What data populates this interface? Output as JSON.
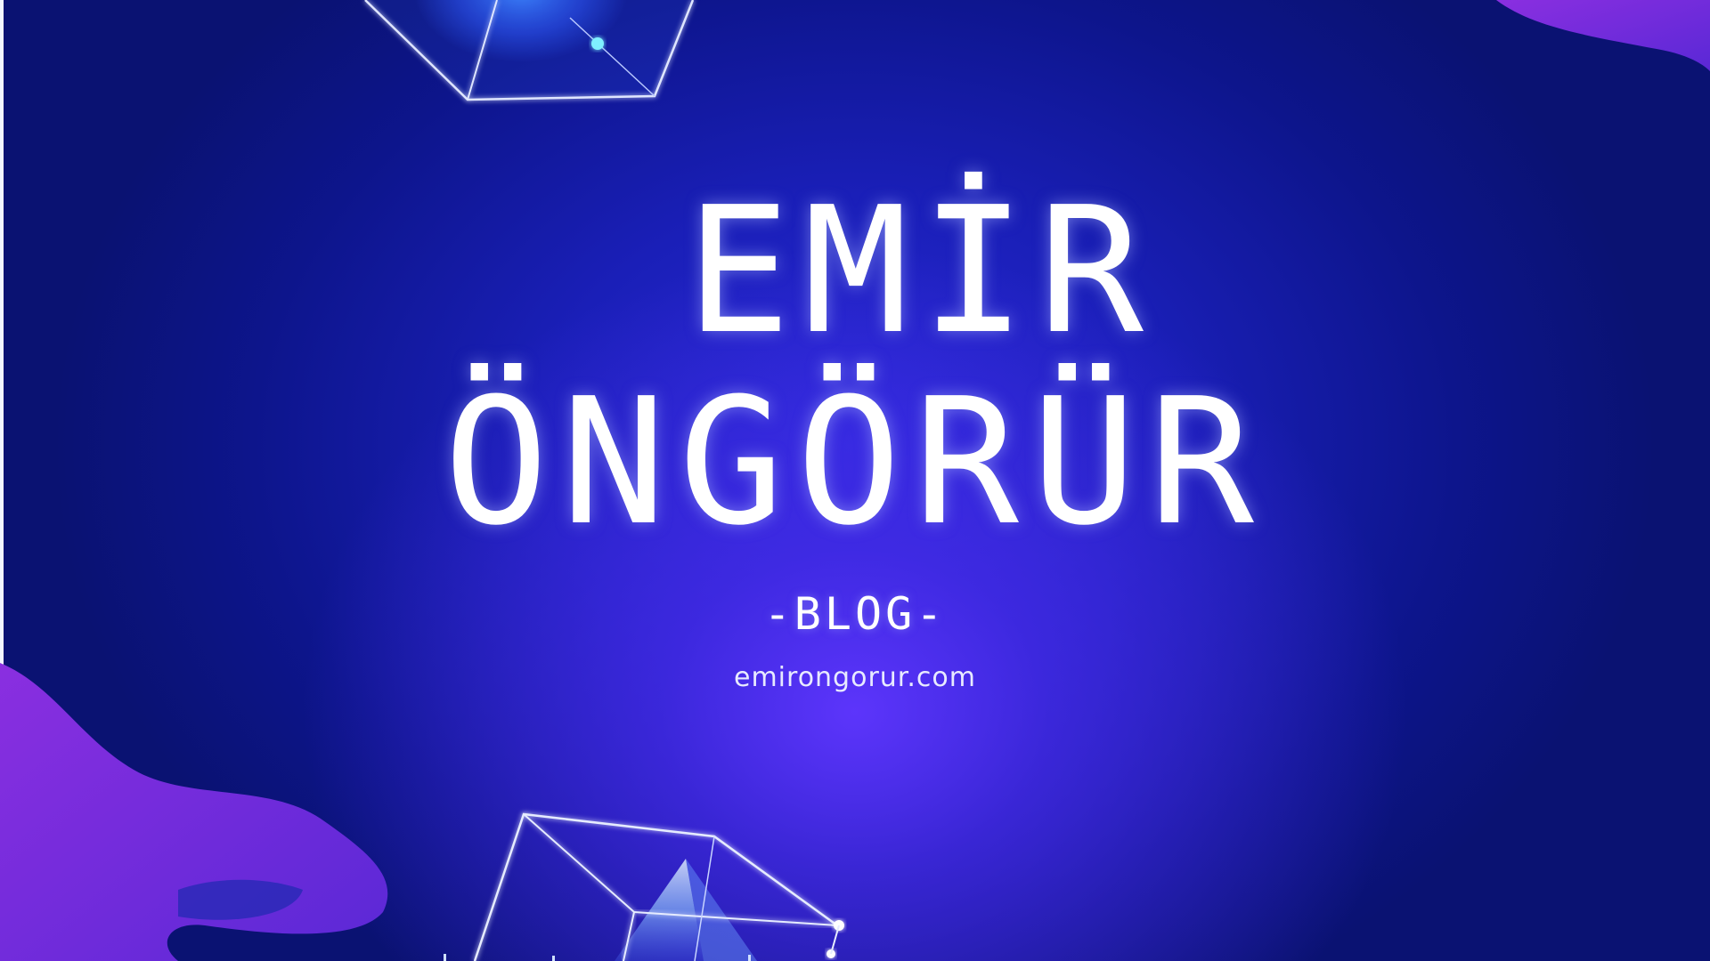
{
  "banner": {
    "title_line1": "EMİR",
    "title_line2": "ÖNGÖRÜR",
    "subtitle": "-BLOG-",
    "url": "emirongorur.com"
  },
  "colors": {
    "background_dark": "#0a1272",
    "background_mid": "#1a1fb8",
    "glow_purple": "#6036ff",
    "accent_purple": "#7a2ad8",
    "text": "#ffffff"
  }
}
